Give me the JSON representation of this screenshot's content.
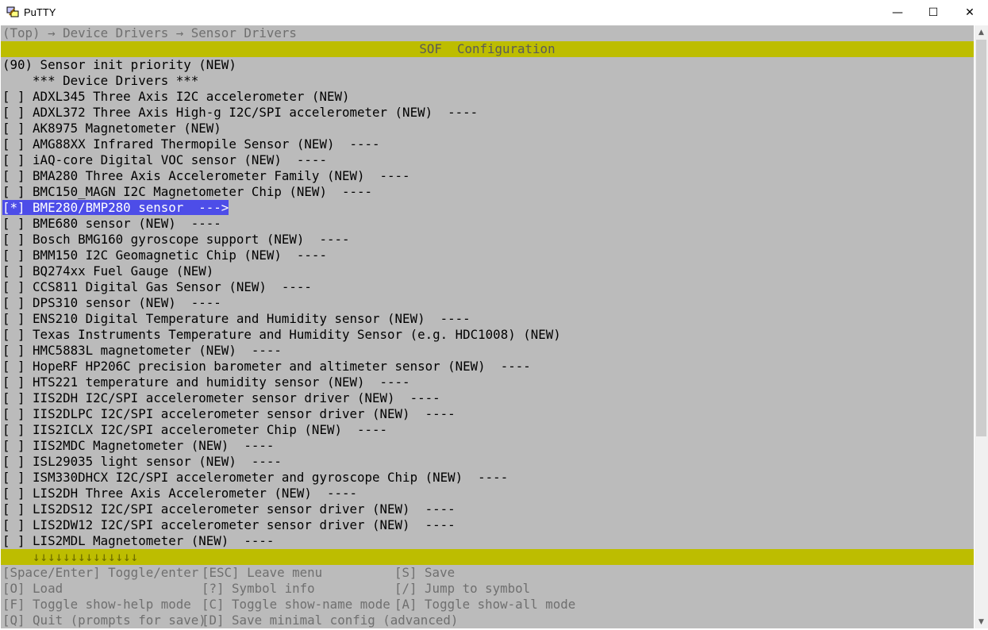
{
  "window": {
    "title": "PuTTY",
    "minimize": "—",
    "maximize": "☐",
    "close": "✕"
  },
  "breadcrumb": "(Top) → Device Drivers → Sensor Drivers",
  "header_title": "SOF  Configuration",
  "menu_items": [
    "(90) Sensor init priority (NEW)",
    "    *** Device Drivers ***",
    "[ ] ADXL345 Three Axis I2C accelerometer (NEW)",
    "[ ] ADXL372 Three Axis High-g I2C/SPI accelerometer (NEW)  ----",
    "[ ] AK8975 Magnetometer (NEW)",
    "[ ] AMG88XX Infrared Thermopile Sensor (NEW)  ----",
    "[ ] iAQ-core Digital VOC sensor (NEW)  ----",
    "[ ] BMA280 Three Axis Accelerometer Family (NEW)  ----",
    "[ ] BMC150_MAGN I2C Magnetometer Chip (NEW)  ----",
    "[*] BME280/BMP280 sensor  --->",
    "[ ] BME680 sensor (NEW)  ----",
    "[ ] Bosch BMG160 gyroscope support (NEW)  ----",
    "[ ] BMM150 I2C Geomagnetic Chip (NEW)  ----",
    "[ ] BQ274xx Fuel Gauge (NEW)",
    "[ ] CCS811 Digital Gas Sensor (NEW)  ----",
    "[ ] DPS310 sensor (NEW)  ----",
    "[ ] ENS210 Digital Temperature and Humidity sensor (NEW)  ----",
    "[ ] Texas Instruments Temperature and Humidity Sensor (e.g. HDC1008) (NEW)",
    "[ ] HMC5883L magnetometer (NEW)  ----",
    "[ ] HopeRF HP206C precision barometer and altimeter sensor (NEW)  ----",
    "[ ] HTS221 temperature and humidity sensor (NEW)  ----",
    "[ ] IIS2DH I2C/SPI accelerometer sensor driver (NEW)  ----",
    "[ ] IIS2DLPC I2C/SPI accelerometer sensor driver (NEW)  ----",
    "[ ] IIS2ICLX I2C/SPI accelerometer Chip (NEW)  ----",
    "[ ] IIS2MDC Magnetometer (NEW)  ----",
    "[ ] ISL29035 light sensor (NEW)  ----",
    "[ ] ISM330DHCX I2C/SPI accelerometer and gyroscope Chip (NEW)  ----",
    "[ ] LIS2DH Three Axis Accelerometer (NEW)  ----",
    "[ ] LIS2DS12 I2C/SPI accelerometer sensor driver (NEW)  ----",
    "[ ] LIS2DW12 I2C/SPI accelerometer sensor driver (NEW)  ----",
    "[ ] LIS2MDL Magnetometer (NEW)  ----"
  ],
  "selected_index": 9,
  "more_indicator": "    ↓↓↓↓↓↓↓↓↓↓↓↓↓↓",
  "footer": {
    "col1": [
      "[Space/Enter] Toggle/enter",
      "[O] Load",
      "[F] Toggle show-help mode",
      "[Q] Quit (prompts for save)"
    ],
    "col2": [
      "[ESC] Leave menu",
      "[?] Symbol info",
      "[C] Toggle show-name mode",
      "[D] Save minimal config (advanced)"
    ],
    "col3": [
      "[S] Save",
      "[/] Jump to symbol",
      "[A] Toggle show-all mode"
    ]
  },
  "scrollbar": {
    "up": "▲",
    "down": "▼"
  },
  "colors": {
    "terminal_bg": "#bbbbbb",
    "title_bar": "#bdbd00",
    "highlight": "#4d4de8",
    "dim_text": "#6f6f6f"
  }
}
